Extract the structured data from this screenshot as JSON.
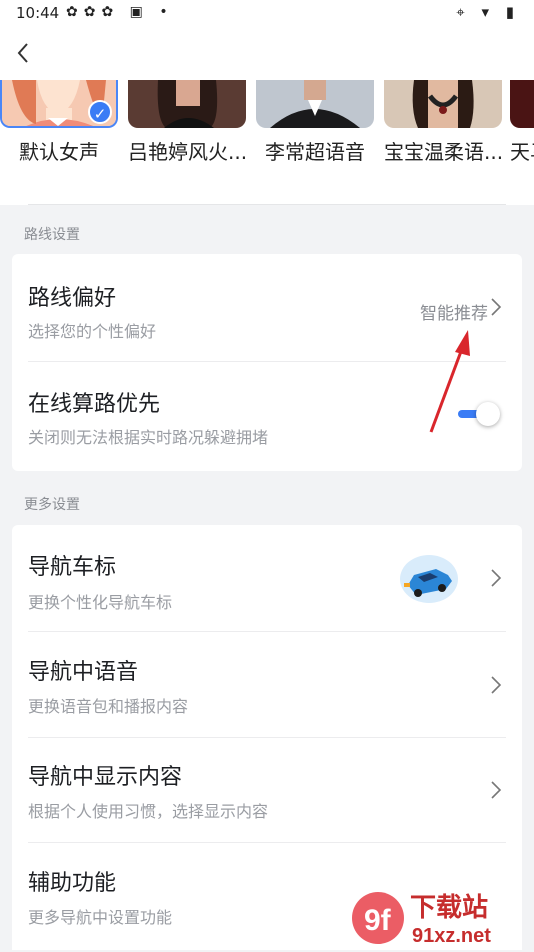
{
  "status_bar": {
    "time": "10:44",
    "left_icons": [
      "app-icon",
      "app-icon",
      "app-icon",
      "a-icon",
      "dot"
    ],
    "right_icons": [
      "location-icon",
      "wifi-icon",
      "battery-icon"
    ]
  },
  "voices": [
    {
      "name": "默认女声",
      "selected": true
    },
    {
      "name": "吕艳婷风火...",
      "selected": false
    },
    {
      "name": "李常超语音",
      "selected": false
    },
    {
      "name": "宝宝温柔语...",
      "selected": false
    },
    {
      "name": "天马",
      "selected": false
    }
  ],
  "route_section": {
    "title": "路线设置",
    "preference": {
      "title": "路线偏好",
      "subtitle": "选择您的个性偏好",
      "value": "智能推荐"
    },
    "online": {
      "title": "在线算路优先",
      "subtitle": "关闭则无法根据实时路况躲避拥堵",
      "enabled": true
    }
  },
  "more_section": {
    "title": "更多设置",
    "items": [
      {
        "title": "导航车标",
        "subtitle": "更换个性化导航车标"
      },
      {
        "title": "导航中语音",
        "subtitle": "更换语音包和播报内容"
      },
      {
        "title": "导航中显示内容",
        "subtitle": "根据个人使用习惯，选择显示内容"
      },
      {
        "title": "辅助功能",
        "subtitle": "更多导航中设置功能"
      }
    ]
  },
  "watermark": {
    "brand": "下载站",
    "domain": "91xz.net",
    "logo": "9f"
  },
  "colors": {
    "accent": "#3a7cf5",
    "annotation_arrow": "#d9262c"
  }
}
